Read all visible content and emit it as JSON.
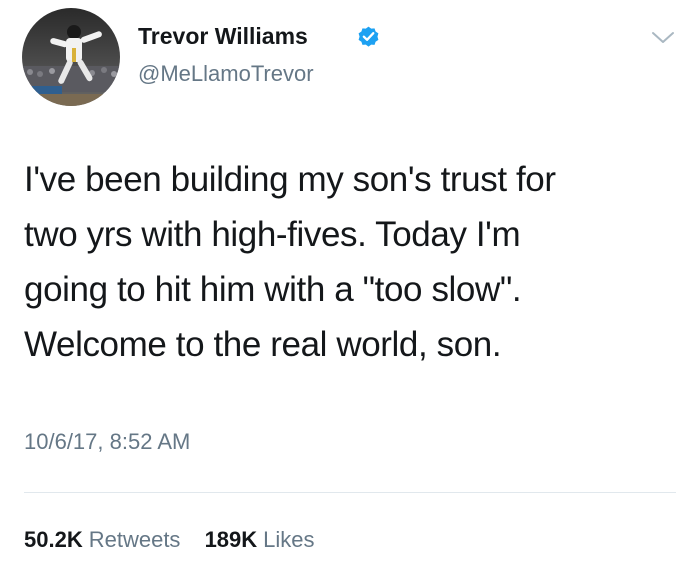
{
  "user": {
    "display_name": "Trevor Williams",
    "handle": "@MeLlamoTrevor",
    "verified": true,
    "verified_color": "#1da1f2"
  },
  "tweet": {
    "text": "I've been building my son's trust for\ntwo yrs with high-fives. Today I'm\ngoing to hit him with a \"too slow\".\nWelcome to the real world, son.",
    "timestamp": "10/6/17, 8:52 AM"
  },
  "stats": {
    "retweets_count": "50.2K",
    "retweets_label": "Retweets",
    "likes_count": "189K",
    "likes_label": "Likes"
  },
  "colors": {
    "text_primary": "#14171a",
    "text_secondary": "#657786",
    "divider": "#e1e8ed"
  },
  "icons": {
    "verified": "verified-badge-icon",
    "menu": "chevron-down-icon"
  }
}
